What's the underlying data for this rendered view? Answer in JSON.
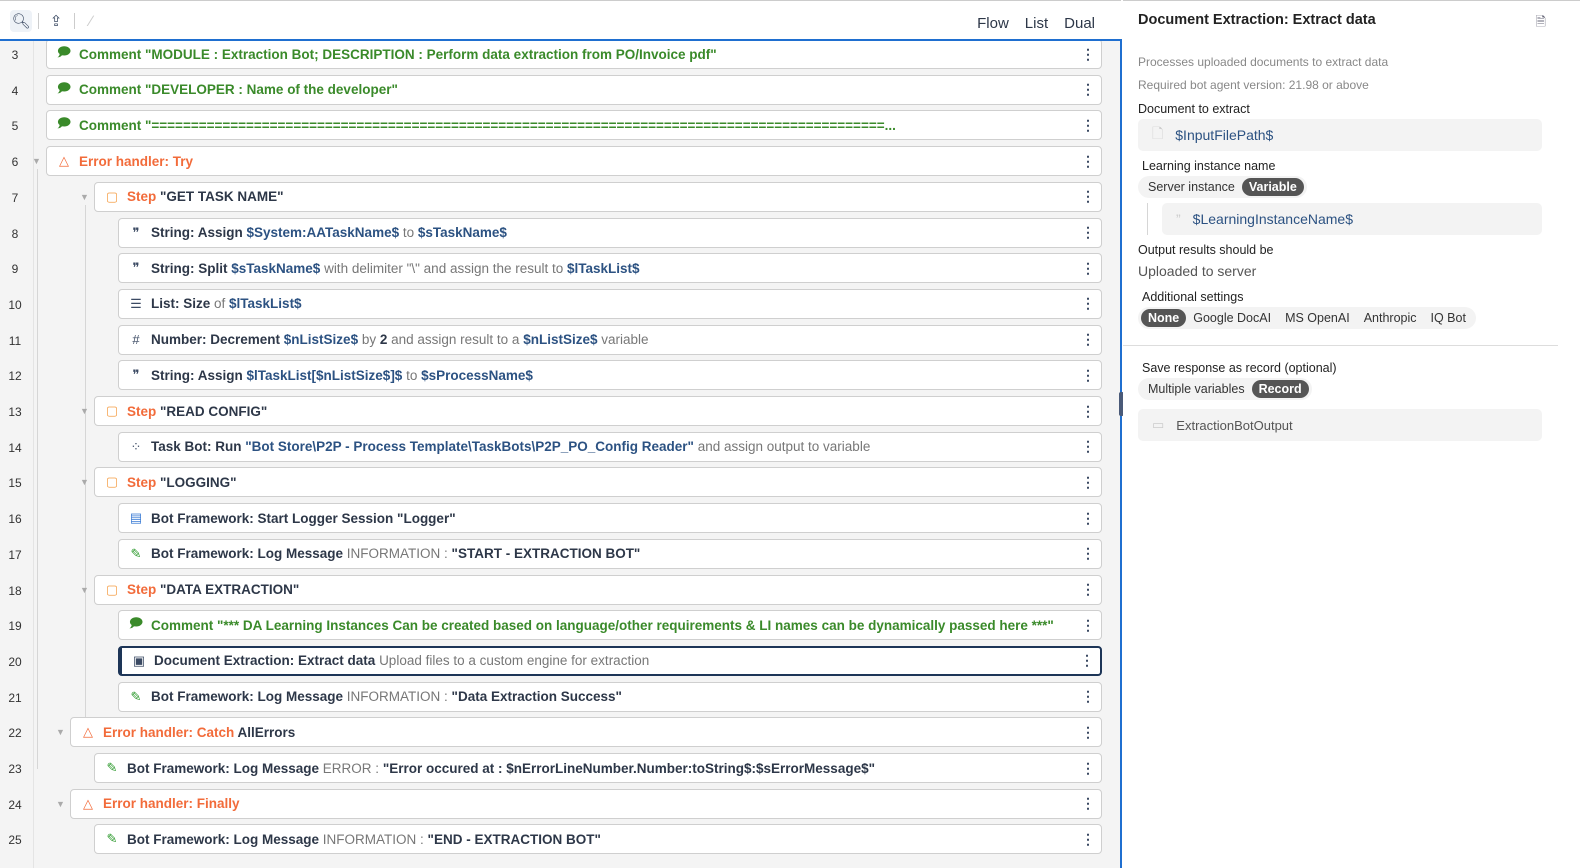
{
  "toolbar": {
    "icons": [
      "search-icon",
      "export-icon",
      "disable-icon"
    ],
    "tabs": [
      {
        "label": "Flow"
      },
      {
        "label": "List",
        "active": true
      },
      {
        "label": "Dual"
      }
    ]
  },
  "rows": [
    {
      "num": "3",
      "indent": 0,
      "icon": "comment-icon",
      "segs": [
        [
          "g",
          "Comment \"MODULE : Extraction Bot; DESCRIPTION : Perform data extraction from PO/Invoice pdf\""
        ]
      ]
    },
    {
      "num": "4",
      "indent": 0,
      "icon": "comment-icon",
      "segs": [
        [
          "g",
          "Comment \"DEVELOPER : Name of the developer\""
        ]
      ]
    },
    {
      "num": "5",
      "indent": 0,
      "icon": "comment-icon",
      "segs": [
        [
          "g",
          "Comment \"=============================================================================================..."
        ]
      ]
    },
    {
      "num": "6",
      "indent": 0,
      "icon": "warning-icon",
      "caret": true,
      "segs": [
        [
          "o",
          "Error handler: Try"
        ]
      ]
    },
    {
      "num": "7",
      "indent": 2,
      "icon": "step-icon",
      "caret": true,
      "segs": [
        [
          "o",
          "Step "
        ],
        [
          "k",
          "\"GET TASK NAME\""
        ]
      ]
    },
    {
      "num": "8",
      "indent": 3,
      "icon": "quote-icon",
      "segs": [
        [
          "k",
          "String: Assign "
        ],
        [
          "v",
          "$System:AATaskName$"
        ],
        [
          "p",
          " to "
        ],
        [
          "v",
          "$sTaskName$"
        ]
      ]
    },
    {
      "num": "9",
      "indent": 3,
      "icon": "quote-icon",
      "segs": [
        [
          "k",
          "String: Split "
        ],
        [
          "v",
          "$sTaskName$"
        ],
        [
          "p",
          " with delimiter \"\\\" and assign the result to "
        ],
        [
          "v",
          "$lTaskList$"
        ]
      ]
    },
    {
      "num": "10",
      "indent": 3,
      "icon": "list-icon",
      "segs": [
        [
          "k",
          "List: Size "
        ],
        [
          "p",
          "of "
        ],
        [
          "v",
          "$lTaskList$"
        ]
      ]
    },
    {
      "num": "11",
      "indent": 3,
      "icon": "hash-icon",
      "segs": [
        [
          "k",
          "Number: Decrement "
        ],
        [
          "v",
          "$nListSize$"
        ],
        [
          "p",
          " by "
        ],
        [
          "k",
          "2"
        ],
        [
          "p",
          " and assign result to a "
        ],
        [
          "v",
          "$nListSize$"
        ],
        [
          "p",
          " variable"
        ]
      ]
    },
    {
      "num": "12",
      "indent": 3,
      "icon": "quote-icon",
      "segs": [
        [
          "k",
          "String: Assign "
        ],
        [
          "v",
          "$lTaskList[$nListSize$]$"
        ],
        [
          "p",
          " to "
        ],
        [
          "v",
          "$sProcessName$"
        ]
      ]
    },
    {
      "num": "13",
      "indent": 2,
      "icon": "step-icon",
      "caret": true,
      "segs": [
        [
          "o",
          "Step "
        ],
        [
          "k",
          "\"READ CONFIG\""
        ]
      ]
    },
    {
      "num": "14",
      "indent": 3,
      "icon": "taskbot-icon",
      "segs": [
        [
          "k",
          "Task Bot: Run "
        ],
        [
          "v",
          "\"Bot Store\\P2P - Process Template\\TaskBots\\P2P_PO_Config Reader\""
        ],
        [
          "p",
          " and assign output to variable"
        ]
      ]
    },
    {
      "num": "15",
      "indent": 2,
      "icon": "step-icon",
      "caret": true,
      "segs": [
        [
          "o",
          "Step "
        ],
        [
          "k",
          "\"LOGGING\""
        ]
      ]
    },
    {
      "num": "16",
      "indent": 3,
      "icon": "logger-icon",
      "segs": [
        [
          "k",
          "Bot Framework: Start Logger Session "
        ],
        [
          "k",
          "\"Logger\""
        ]
      ]
    },
    {
      "num": "17",
      "indent": 3,
      "icon": "pen-icon",
      "segs": [
        [
          "k",
          "Bot Framework: Log Message "
        ],
        [
          "p",
          "INFORMATION : "
        ],
        [
          "k",
          "\"START - EXTRACTION BOT\""
        ]
      ]
    },
    {
      "num": "18",
      "indent": 2,
      "icon": "step-icon",
      "caret": true,
      "segs": [
        [
          "o",
          "Step "
        ],
        [
          "k",
          "\"DATA EXTRACTION\""
        ]
      ]
    },
    {
      "num": "19",
      "indent": 3,
      "icon": "comment-icon",
      "segs": [
        [
          "g",
          "Comment \"*** DA Learning Instances Can be created based on language/other requirements & LI names can be dynamically passed here ***\""
        ]
      ]
    },
    {
      "num": "20",
      "indent": 3,
      "icon": "document-extraction-icon",
      "selected": true,
      "segs": [
        [
          "k",
          "Document Extraction: Extract data "
        ],
        [
          "p",
          "Upload files to a custom engine for extraction"
        ]
      ]
    },
    {
      "num": "21",
      "indent": 3,
      "icon": "pen-icon",
      "segs": [
        [
          "k",
          "Bot Framework: Log Message "
        ],
        [
          "p",
          "INFORMATION : "
        ],
        [
          "k",
          "\"Data Extraction Success\""
        ]
      ]
    },
    {
      "num": "22",
      "indent": 1,
      "icon": "warning-icon",
      "caret": true,
      "segs": [
        [
          "o",
          "Error handler: Catch "
        ],
        [
          "k",
          "AllErrors"
        ]
      ]
    },
    {
      "num": "23",
      "indent": 2,
      "icon": "pen-icon",
      "segs": [
        [
          "k",
          "Bot Framework: Log Message "
        ],
        [
          "p",
          "ERROR : "
        ],
        [
          "k",
          "\"Error occured at : $nErrorLineNumber.Number:toString$:$sErrorMessage$\""
        ]
      ]
    },
    {
      "num": "24",
      "indent": 1,
      "icon": "warning-icon",
      "caret": true,
      "segs": [
        [
          "o",
          "Error handler: Finally"
        ]
      ]
    },
    {
      "num": "25",
      "indent": 2,
      "icon": "pen-icon",
      "segs": [
        [
          "k",
          "Bot Framework: Log Message "
        ],
        [
          "p",
          "INFORMATION : "
        ],
        [
          "k",
          "\"END - EXTRACTION BOT\""
        ]
      ]
    }
  ],
  "panel": {
    "title": "Document Extraction: Extract data",
    "description": "Processes uploaded documents to extract data",
    "version": "Required bot agent version: 21.98 or above",
    "doc_label": "Document to extract",
    "doc_value": "$InputFilePath$",
    "li_label": "Learning instance name",
    "li_options": [
      {
        "label": "Server instance"
      },
      {
        "label": "Variable",
        "active": true
      }
    ],
    "li_value": "$LearningInstanceName$",
    "output_label": "Output results should be",
    "output_value": "Uploaded to server",
    "additional_label": "Additional settings",
    "additional_options": [
      {
        "label": "None",
        "active": true
      },
      {
        "label": "Google DocAI"
      },
      {
        "label": "MS OpenAI"
      },
      {
        "label": "Anthropic"
      },
      {
        "label": "IQ Bot"
      }
    ],
    "save_label": "Save response as record (optional)",
    "save_options": [
      {
        "label": "Multiple variables"
      },
      {
        "label": "Record",
        "active": true
      }
    ],
    "save_value": "ExtractionBotOutput"
  }
}
